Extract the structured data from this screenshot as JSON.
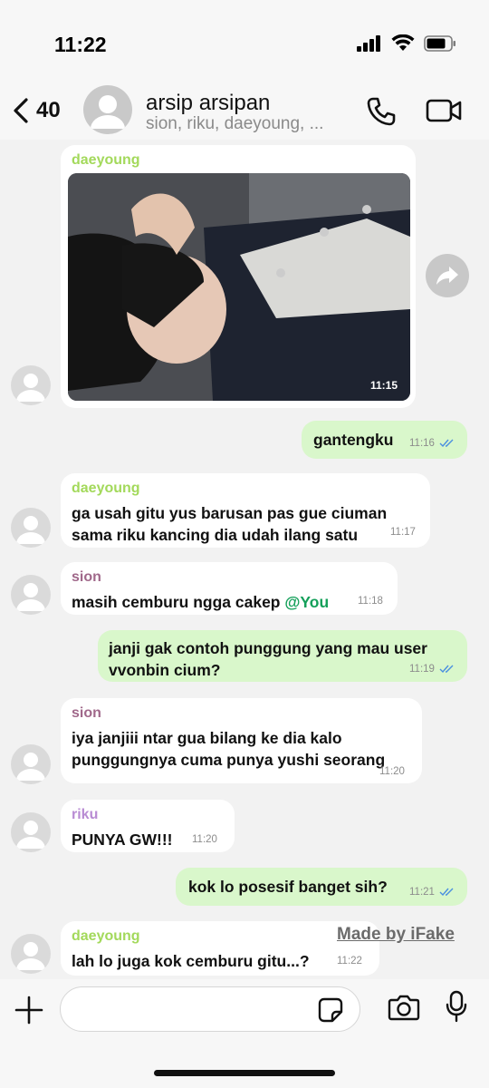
{
  "status": {
    "time": "11:22"
  },
  "header": {
    "back_count": "40",
    "title": "arsip arsipan",
    "subtitle": "sion, riku, daeyoung, ..."
  },
  "colors": {
    "daeyoung": "#a3d95b",
    "sion": "#a0688a",
    "riku": "#b88bd3",
    "mention": "#14a05a",
    "tick": "#4a8fe0"
  },
  "messages": [
    {
      "sender": "daeyoung",
      "type": "photo",
      "time": "11:15"
    },
    {
      "sender": "You",
      "text": "gantengku",
      "time": "11:16"
    },
    {
      "sender": "daeyoung",
      "line1": "ga usah gitu yus barusan pas gue ciuman",
      "line2": "sama riku kancing dia udah ilang satu",
      "time": "11:17"
    },
    {
      "sender": "sion",
      "text": "masih cemburu ngga cakep ",
      "mention": "@You",
      "time": "11:18"
    },
    {
      "sender": "You",
      "line1": "janji gak contoh punggung yang mau user",
      "line2": "vvonbin cium?",
      "time": "11:19"
    },
    {
      "sender": "sion",
      "line1": "iya janjiii ntar gua bilang ke dia kalo",
      "line2": "punggungnya cuma punya yushi seorang",
      "time": "11:20"
    },
    {
      "sender": "riku",
      "text": "PUNYA GW!!!",
      "time": "11:20"
    },
    {
      "sender": "You",
      "text": "kok lo posesif banget sih?",
      "time": "11:21"
    },
    {
      "sender": "daeyoung",
      "text": "lah lo juga kok cemburu gitu...?",
      "time": "11:22"
    }
  ],
  "watermark": "Made by iFake",
  "icons": [
    "back-chevron-icon",
    "phone-icon",
    "video-camera-icon",
    "forward-icon",
    "plus-icon",
    "sticker-icon",
    "camera-icon",
    "microphone-icon"
  ]
}
